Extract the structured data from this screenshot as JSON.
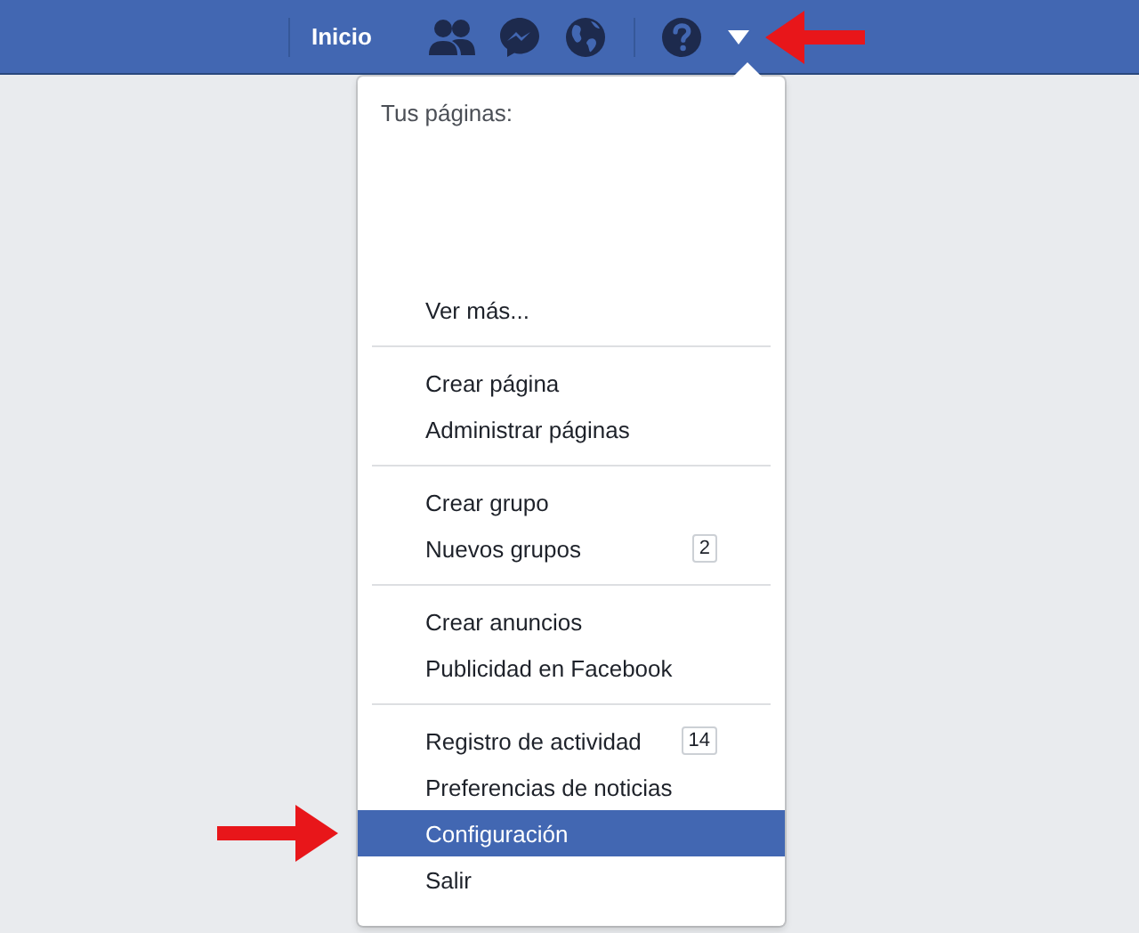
{
  "top_bar": {
    "home_link": "Inicio"
  },
  "account_menu": {
    "heading": "Tus páginas:",
    "groups": [
      {
        "items": [
          {
            "label": "Ver más...",
            "selected": false
          }
        ]
      },
      {
        "items": [
          {
            "label": "Crear página",
            "selected": false
          },
          {
            "label": "Administrar páginas",
            "selected": false
          }
        ]
      },
      {
        "items": [
          {
            "label": "Crear grupo",
            "selected": false
          },
          {
            "label": "Nuevos grupos",
            "badge": "2",
            "selected": false
          }
        ]
      },
      {
        "items": [
          {
            "label": "Crear anuncios",
            "selected": false
          },
          {
            "label": "Publicidad en Facebook",
            "selected": false
          }
        ]
      },
      {
        "items": [
          {
            "label": "Registro de actividad",
            "badge": "14",
            "selected": false
          },
          {
            "label": "Preferencias de noticias",
            "selected": false
          },
          {
            "label": "Configuración",
            "selected": true
          },
          {
            "label": "Salir",
            "selected": false
          }
        ]
      }
    ]
  }
}
